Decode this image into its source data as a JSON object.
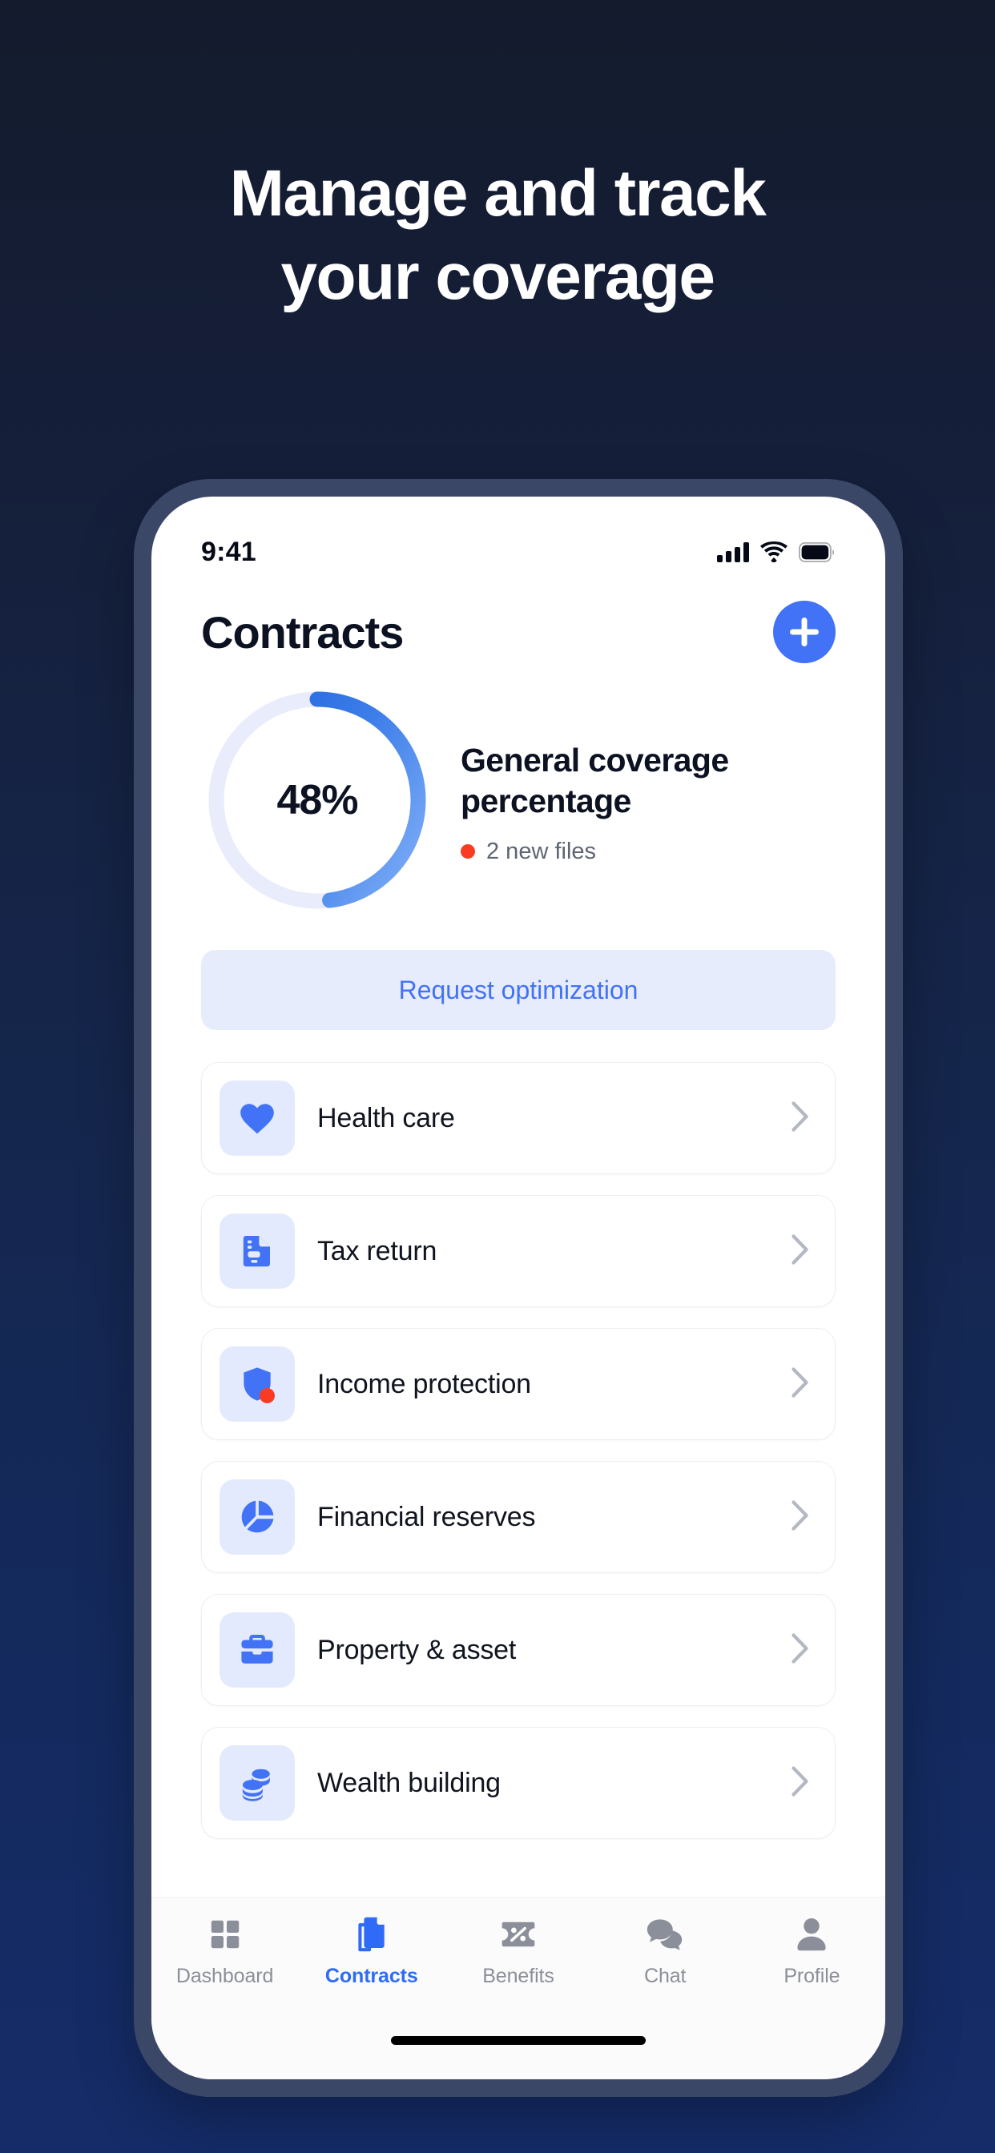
{
  "promo": {
    "headline_line1": "Manage and track",
    "headline_line2": "your coverage",
    "background_top_color": "#141b2d",
    "background_bottom_color": "#152c69",
    "frame_color": "#3b4767"
  },
  "status_bar": {
    "time": "9:41",
    "icons": [
      "cellular-signal-icon",
      "wifi-icon",
      "battery-icon"
    ],
    "battery_full": true
  },
  "header": {
    "title": "Contracts",
    "add_button_label": "+",
    "add_button_color": "#4272f5"
  },
  "coverage": {
    "percent_label": "48%",
    "percent_value": 48,
    "title": "General coverage percentage",
    "new_files_label": "2 new files",
    "new_files_count": 2,
    "dot_color": "#f93b23",
    "ring_track_color": "#e8ecfb",
    "ring_gradient_start": "#1f63de",
    "ring_gradient_end": "#74a6f5"
  },
  "request_button": {
    "label": "Request optimization",
    "text_color": "#4272f5",
    "background_color": "#e7ecfd"
  },
  "contracts_list": [
    {
      "label": "Health care",
      "icon": "heart-icon",
      "badge": false
    },
    {
      "label": "Tax return",
      "icon": "document-icon",
      "badge": false
    },
    {
      "label": "Income protection",
      "icon": "shield-icon",
      "badge": true
    },
    {
      "label": "Financial reserves",
      "icon": "pie-chart-icon",
      "badge": false
    },
    {
      "label": "Property & asset",
      "icon": "briefcase-icon",
      "badge": false
    },
    {
      "label": "Wealth building",
      "icon": "coins-icon",
      "badge": false
    }
  ],
  "tabbar": {
    "active_color": "#2f6bf6",
    "inactive_color": "#8b8f99",
    "items": [
      {
        "label": "Dashboard",
        "icon": "grid-icon",
        "active": false
      },
      {
        "label": "Contracts",
        "icon": "documents-icon",
        "active": true
      },
      {
        "label": "Benefits",
        "icon": "ticket-percent-icon",
        "active": false
      },
      {
        "label": "Chat",
        "icon": "chat-bubbles-icon",
        "active": false
      },
      {
        "label": "Profile",
        "icon": "person-icon",
        "active": false
      }
    ]
  }
}
